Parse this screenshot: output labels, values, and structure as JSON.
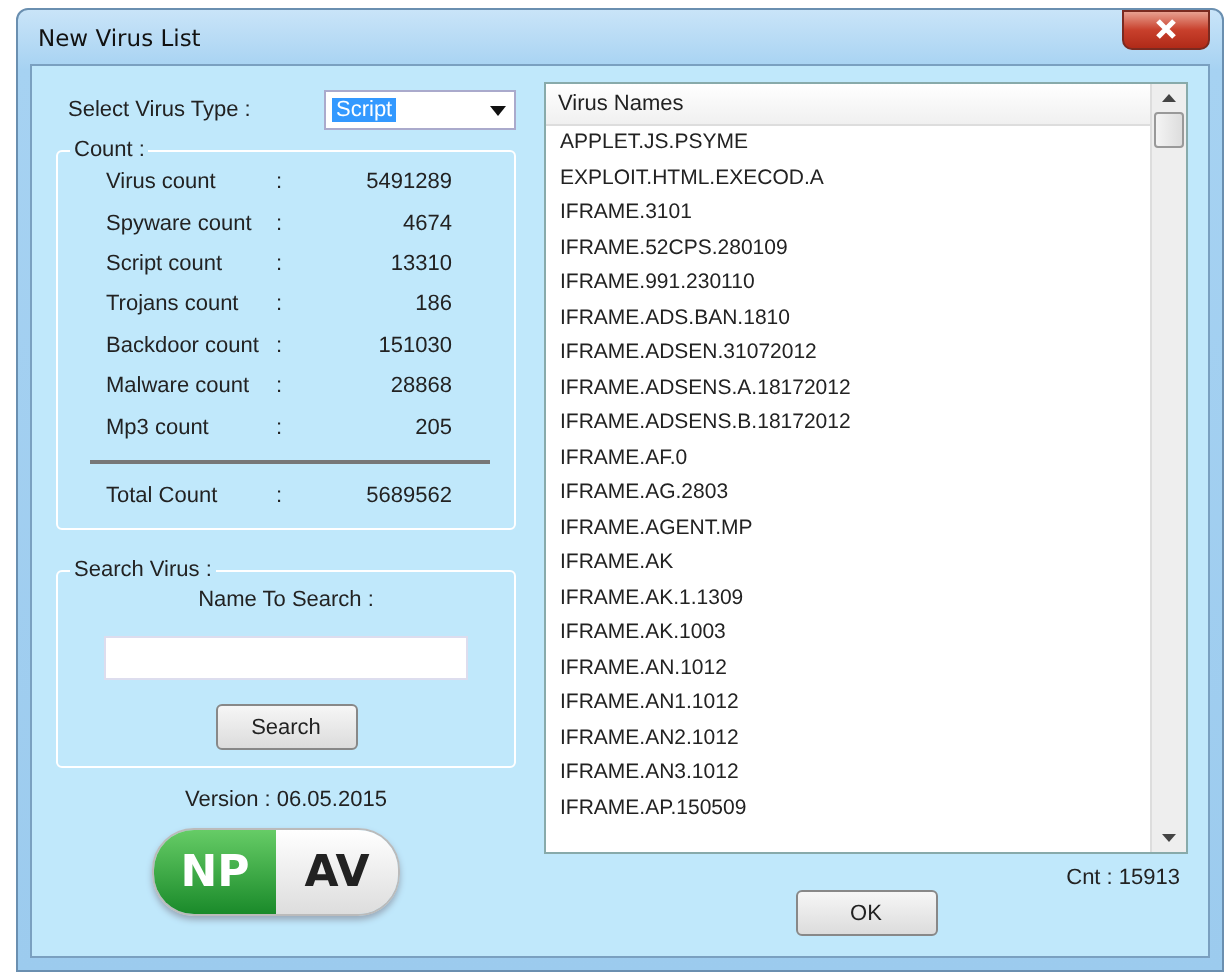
{
  "window": {
    "title": "New Virus List"
  },
  "virus_type": {
    "label": "Select Virus Type :",
    "value": "Script"
  },
  "count": {
    "legend": "Count :",
    "rows": [
      {
        "label": "Virus count",
        "sep": ":",
        "value": "5491289"
      },
      {
        "label": "Spyware count",
        "sep": ":",
        "value": "4674"
      },
      {
        "label": "Script count",
        "sep": ":",
        "value": "13310"
      },
      {
        "label": "Trojans count",
        "sep": ":",
        "value": "186"
      },
      {
        "label": "Backdoor count",
        "sep": ":",
        "value": "151030"
      },
      {
        "label": "Malware count",
        "sep": ":",
        "value": "28868"
      },
      {
        "label": "Mp3 count",
        "sep": ":",
        "value": "205"
      }
    ],
    "total": {
      "label": "Total Count",
      "sep": ":",
      "value": "5689562"
    }
  },
  "search": {
    "legend": "Search Virus :",
    "label": "Name To Search :",
    "button": "Search"
  },
  "version": "Version : 06.05.2015",
  "logo": {
    "left": "NP",
    "right": "AV"
  },
  "virus_list": {
    "header": "Virus Names",
    "items": [
      "APPLET.JS.PSYME",
      "EXPLOIT.HTML.EXECOD.A",
      "IFRAME.3101",
      "IFRAME.52CPS.280109",
      "IFRAME.991.230110",
      "IFRAME.ADS.BAN.1810",
      "IFRAME.ADSEN.31072012",
      "IFRAME.ADSENS.A.18172012",
      "IFRAME.ADSENS.B.18172012",
      "IFRAME.AF.0",
      "IFRAME.AG.2803",
      "IFRAME.AGENT.MP",
      "IFRAME.AK",
      "IFRAME.AK.1.1309",
      "IFRAME.AK.1003",
      "IFRAME.AN.1012",
      "IFRAME.AN1.1012",
      "IFRAME.AN2.1012",
      "IFRAME.AN3.1012",
      "IFRAME.AP.150509"
    ],
    "count": "Cnt : 15913"
  },
  "ok_button": "OK"
}
